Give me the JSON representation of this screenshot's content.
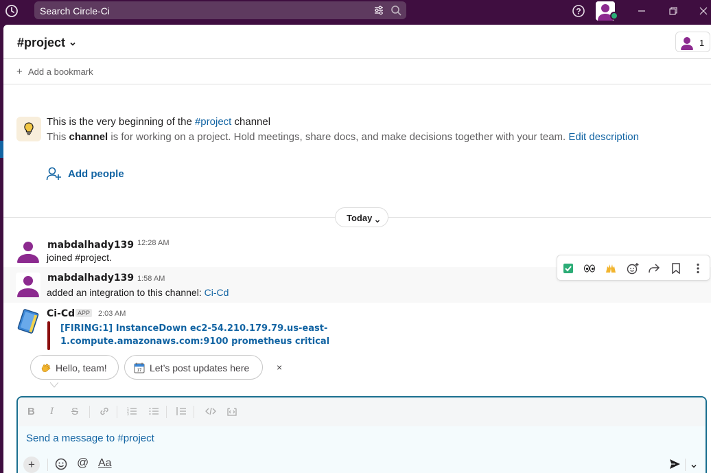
{
  "topbar": {
    "search_placeholder": "Search Circle-Ci",
    "icons": [
      "history-icon",
      "filter-icon",
      "search-icon",
      "help-icon",
      "user-avatar",
      "minimize-icon",
      "maximize-icon",
      "close-icon"
    ]
  },
  "channel": {
    "title": "#project",
    "member_count": "1",
    "bookmark_label": "Add a bookmark"
  },
  "intro": {
    "title_prefix": "This is the very beginning of the ",
    "title_channel": "#project",
    "title_suffix": " channel",
    "desc_prefix": "This ",
    "desc_bold": "channel",
    "desc_rest": " is for working on a project. Hold meetings, share docs, and make decisions together with your team. ",
    "desc_link": "Edit description",
    "add_people": "Add people"
  },
  "divider": {
    "label": "Today"
  },
  "messages": [
    {
      "author": "mabdalhady139",
      "time": "12:28 AM",
      "text": "joined #project."
    },
    {
      "author": "mabdalhady139",
      "time": "1:58 AM",
      "text": "added an integration to this channel: ",
      "link": "Ci-Cd"
    },
    {
      "author": "Ci-Cd",
      "badge": "APP",
      "time": "2:03 AM",
      "alert_line1": "[FIRING:1] InstanceDown ec2-54.210.179.79.us-east-",
      "alert_line2": "1.compute.amazonaws.com:9100 prometheus critical"
    }
  ],
  "hover_toolbar": {
    "items": [
      "check-mark-reaction",
      "eyes-reaction",
      "raised-hands-reaction",
      "add-reaction-icon",
      "share-icon",
      "bookmark-icon",
      "more-actions-icon"
    ],
    "emoji": [
      "✅",
      "👀",
      "🙌"
    ]
  },
  "suggestions": {
    "chip1": "Hello, team!",
    "chip2": "Let’s post updates here",
    "close": "×"
  },
  "composer": {
    "placeholder": "Send a message to #project",
    "mention": "@",
    "format": "Aa",
    "plus": "+"
  },
  "colors": {
    "sidebar": "#3f0e40",
    "link": "#1264a3",
    "alert_bar": "#8b0e0e",
    "composer_border": "#1a6f8f"
  }
}
